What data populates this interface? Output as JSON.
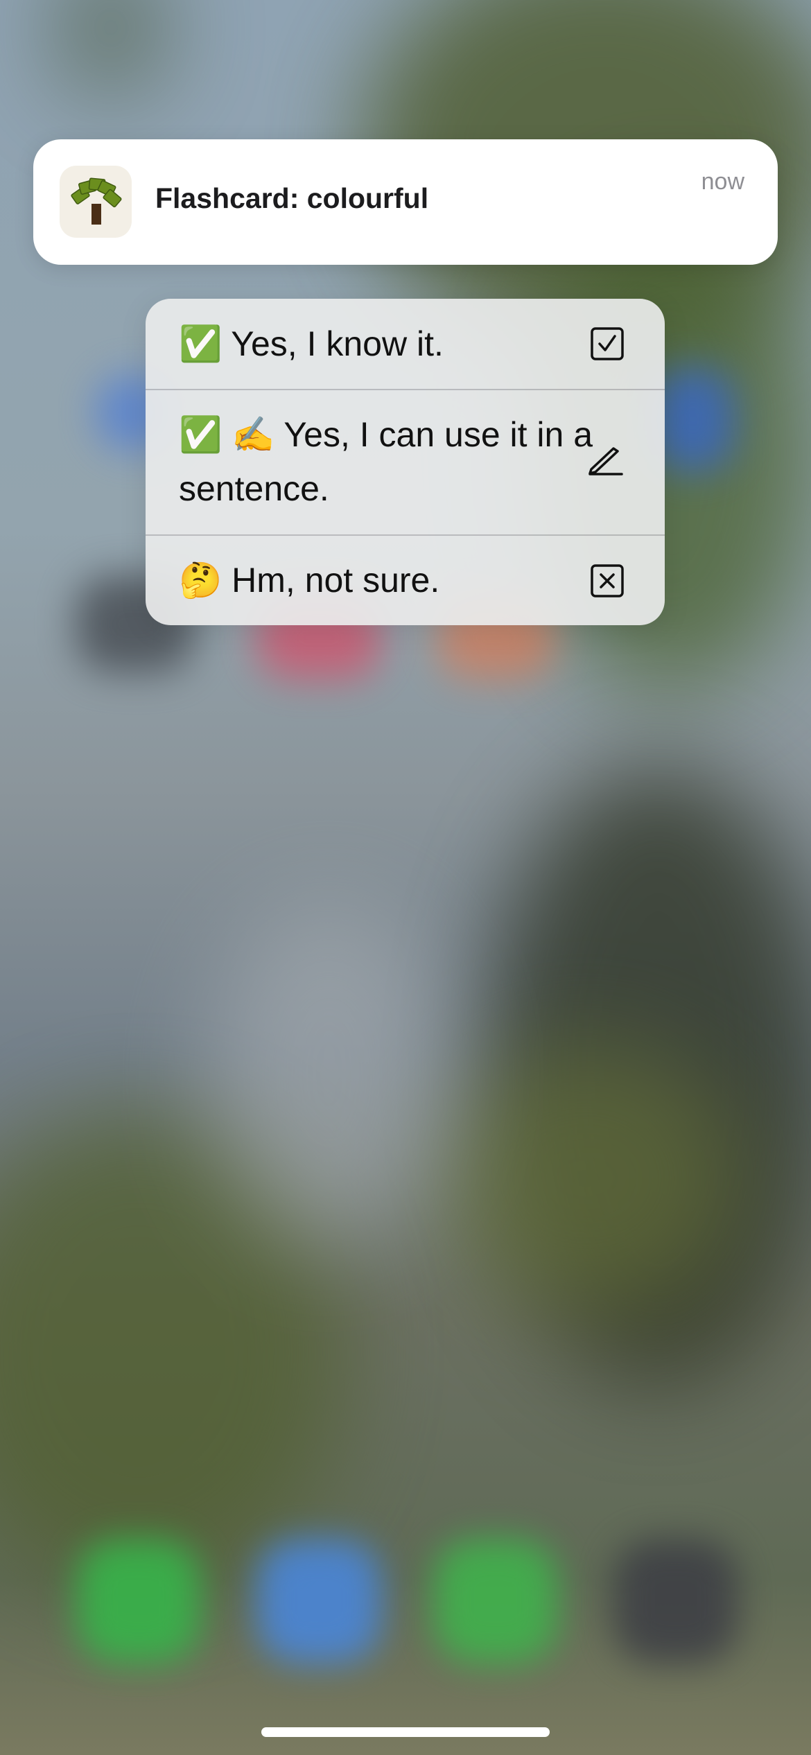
{
  "notification": {
    "app_icon": "flashcard-tree-icon",
    "title": "Flashcard: colourful",
    "time": "now"
  },
  "actions": [
    {
      "label": "✅ Yes, I know it.",
      "icon": "checkbox-checked-icon"
    },
    {
      "label": "✅ ✍️ Yes, I can use it in a sentence.",
      "icon": "pencil-icon"
    },
    {
      "label": "🤔 Hm, not sure.",
      "icon": "close-box-icon"
    }
  ],
  "colors": {
    "notification_bg": "#ffffff",
    "menu_bg": "#eaeceb",
    "text": "#111111",
    "time_text": "#8e8e93"
  }
}
